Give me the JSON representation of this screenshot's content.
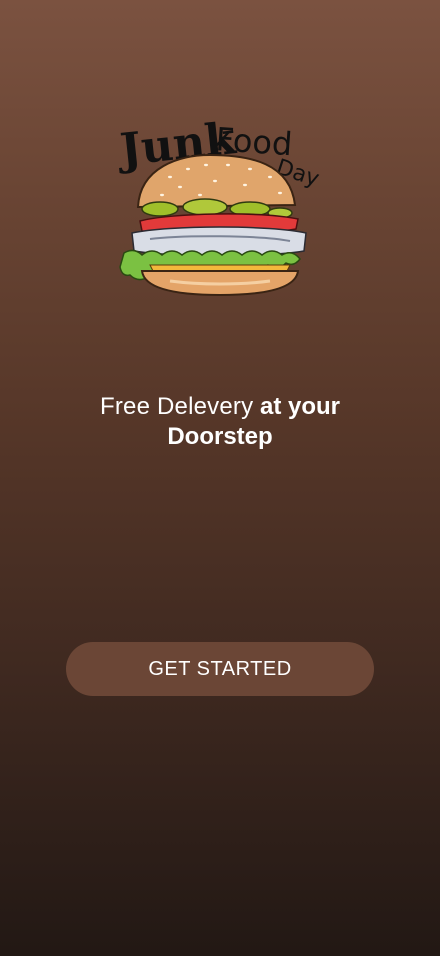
{
  "logo": {
    "text_word1": "Junk",
    "text_word2": "Food",
    "text_word3": "Day",
    "icon": "burger-illustration"
  },
  "tagline": {
    "light": "Free Delevery",
    "bold_line1": "at your",
    "bold_line2": "Doorstep"
  },
  "cta": {
    "label": "GET STARTED"
  },
  "colors": {
    "background_top": "#7b5240",
    "background_bottom": "#221814",
    "button": "#6b4636",
    "text": "#ffffff"
  }
}
